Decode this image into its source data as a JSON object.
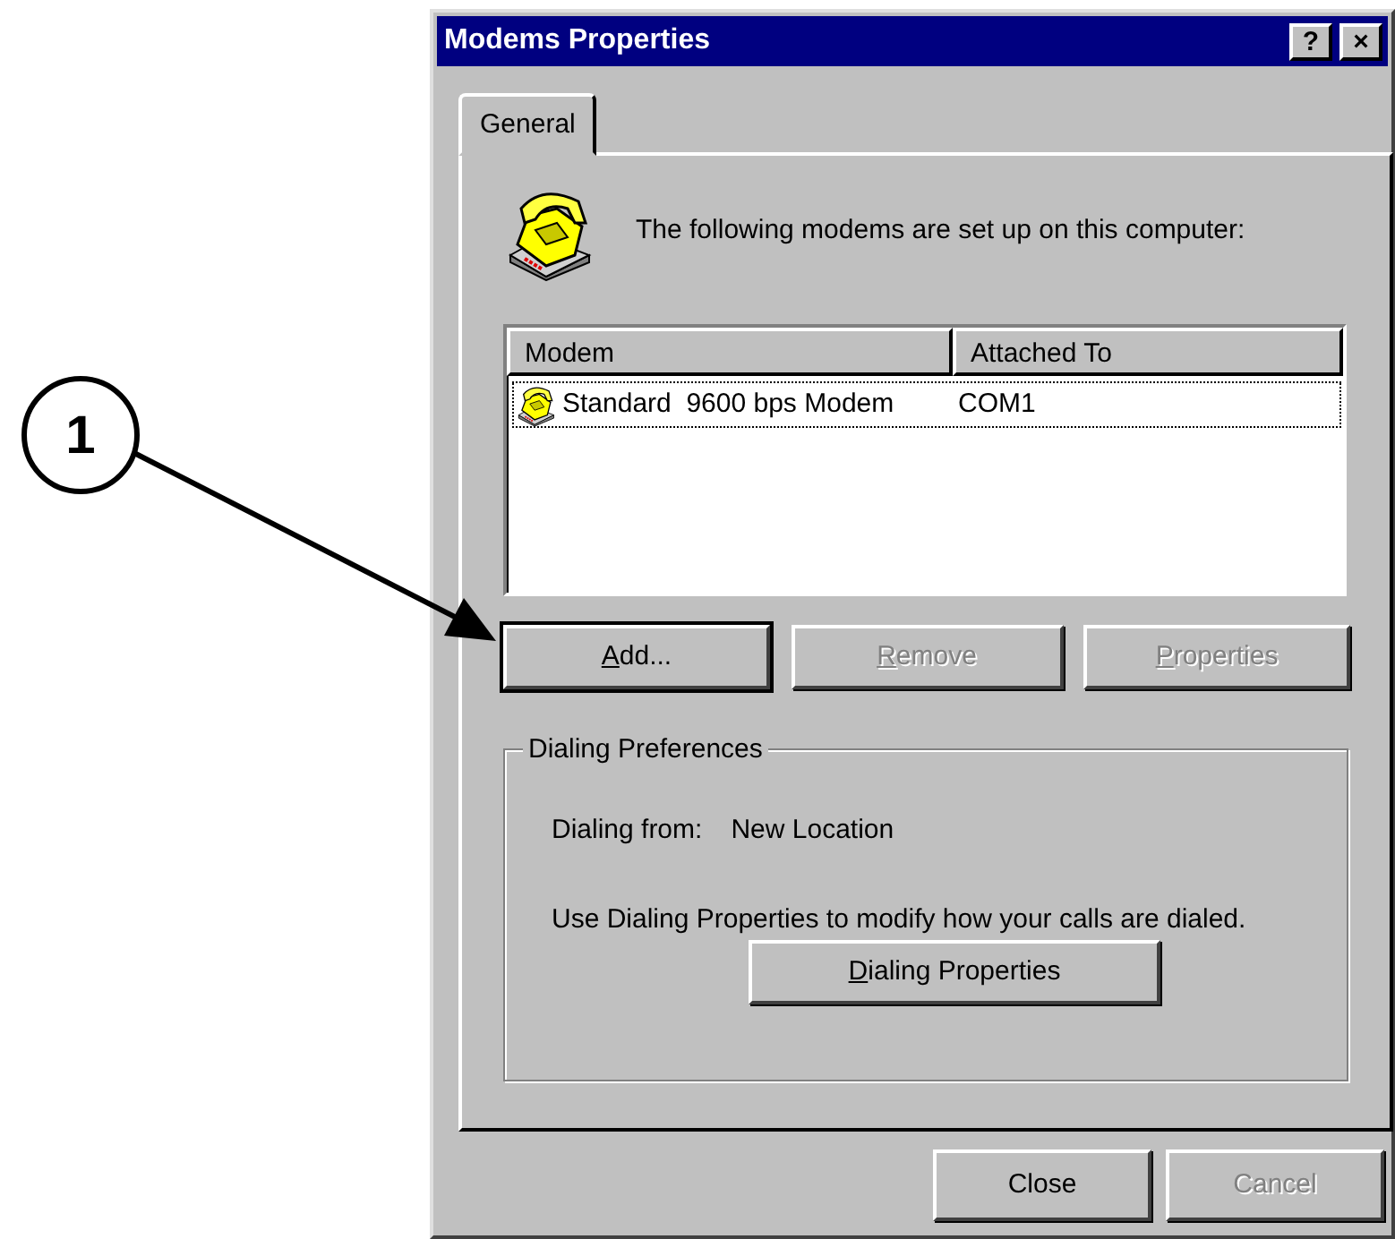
{
  "window": {
    "title": "Modems Properties",
    "title_buttons": [
      "?",
      "×"
    ]
  },
  "tabs": [
    {
      "label": "General",
      "selected": true
    }
  ],
  "intro": "The following modems are set up on this computer:",
  "modem_list": {
    "columns": [
      "Modem",
      "Attached To"
    ],
    "rows": [
      {
        "cells": [
          "Standard  9600 bps Modem",
          "COM1"
        ],
        "selected": true
      }
    ]
  },
  "list_buttons": [
    {
      "label": "Add...",
      "mnemonic": true,
      "default": true,
      "disabled": false
    },
    {
      "label": "Remove",
      "mnemonic": true,
      "default": false,
      "disabled": true
    },
    {
      "label": "Properties",
      "mnemonic": true,
      "default": false,
      "disabled": true
    }
  ],
  "dialing_preferences": {
    "title": "Dialing Preferences",
    "dialing_from_label": "Dialing from:",
    "dialing_from_value": "New Location",
    "help": "Use Dialing Properties to modify how your calls are dialed.",
    "button": {
      "label": "Dialing Properties",
      "mnemonic": true,
      "default": false,
      "disabled": false
    }
  },
  "footer_buttons": [
    {
      "label": "Close",
      "mnemonic": false,
      "default": false,
      "disabled": false
    },
    {
      "label": "Cancel",
      "mnemonic": false,
      "default": false,
      "disabled": true
    }
  ],
  "callout": {
    "label": "1"
  }
}
